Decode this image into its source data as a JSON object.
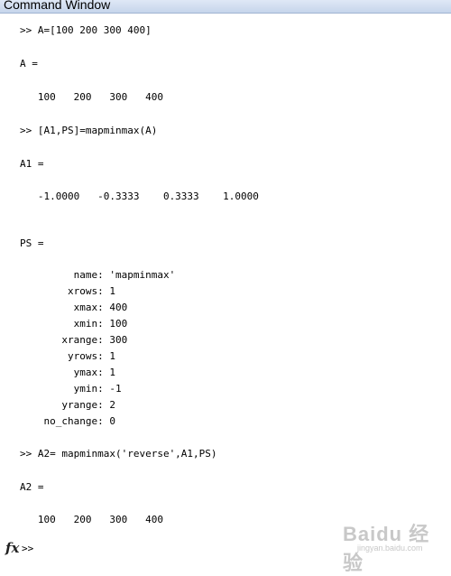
{
  "window": {
    "title": "Command Window"
  },
  "console": {
    "lines": [
      ">> A=[100 200 300 400]",
      "A =",
      "   100   200   300   400",
      ">> [A1,PS]=mapminmax(A)",
      "A1 =",
      "   -1.0000   -0.3333    0.3333    1.0000",
      "PS =",
      "         name: 'mapminmax'",
      "        xrows: 1",
      "         xmax: 400",
      "         xmin: 100",
      "       xrange: 300",
      "        yrows: 1",
      "         ymax: 1",
      "         ymin: -1",
      "       yrange: 2",
      "    no_change: 0",
      ">> A2= mapminmax('reverse',A1,PS)",
      "A2 =",
      "   100   200   300   400"
    ],
    "prompt": ">>"
  },
  "watermark": {
    "logo_text": "Baidu 经验",
    "url": "jingyan.baidu.com"
  }
}
